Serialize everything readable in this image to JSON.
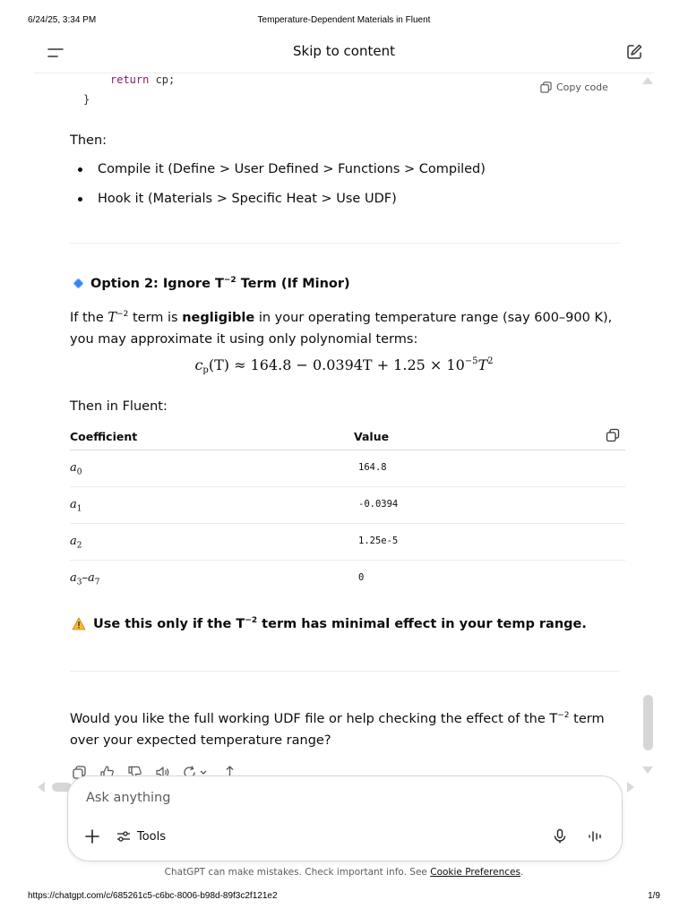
{
  "print": {
    "datetime": "6/24/25, 3:34 PM",
    "doc_title": "Temperature-Dependent Materials in Fluent",
    "url": "https://chatgpt.com/c/685261c5-c6bc-8006-b98d-89f3c2f121e2",
    "page": "1/9"
  },
  "topbar": {
    "skip_label": "Skip to content",
    "menu_icon": "sidebar-menu-icon",
    "new_chat_icon": "new-chat-icon"
  },
  "code": {
    "keyword": "return",
    "rest": " cp;",
    "closing": "}",
    "copy_label": "Copy code"
  },
  "content": {
    "then_1": "Then:",
    "bullets": [
      "Compile it (Define > User Defined > Functions > Compiled)",
      "Hook it (Materials > Specific Heat > Use UDF)"
    ],
    "option2_pre": "Option 2: Ignore T",
    "option2_sup": "−2",
    "option2_post": " Term (If Minor)",
    "para1_a": "If the ",
    "para1_T": "T",
    "para1_sup": "−2",
    "para1_b": " term is ",
    "para1_bold": "negligible",
    "para1_c": " in your operating temperature range (say 600–900 K), you may approximate it using only polynomial terms:",
    "eq_a": "c",
    "eq_sub": "p",
    "eq_b": "(T) ≈ 164.8 − 0.0394T + 1.25 × 10",
    "eq_sup1": "−5",
    "eq_c": "T",
    "eq_sup2": "2",
    "then_2": "Then in Fluent:",
    "warn_pre": "Use this only if the T",
    "warn_sup": "−2",
    "warn_post": " term has minimal effect in your temp range.",
    "para2_a": "Would you like the full working UDF file or help checking the effect of the T",
    "para2_sup": "−2",
    "para2_b": " term over your expected temperature range?"
  },
  "table": {
    "headers": [
      "Coefficient",
      "Value"
    ],
    "rows": [
      {
        "sym": "a",
        "sub": "0",
        "suffix": "",
        "value": "164.8"
      },
      {
        "sym": "a",
        "sub": "1",
        "suffix": "",
        "value": "-0.0394"
      },
      {
        "sym": "a",
        "sub": "2",
        "suffix": "",
        "value": "1.25e-5"
      },
      {
        "sym": "a",
        "sub": "3",
        "suffix": "–a",
        "sub2": "7",
        "value": "0"
      }
    ]
  },
  "composer": {
    "placeholder": "Ask anything",
    "tools_label": "Tools"
  },
  "footer": {
    "disclaimer_pre": "ChatGPT can make mistakes. Check important info. See ",
    "disclaimer_link": "Cookie Preferences",
    "disclaimer_post": "."
  }
}
